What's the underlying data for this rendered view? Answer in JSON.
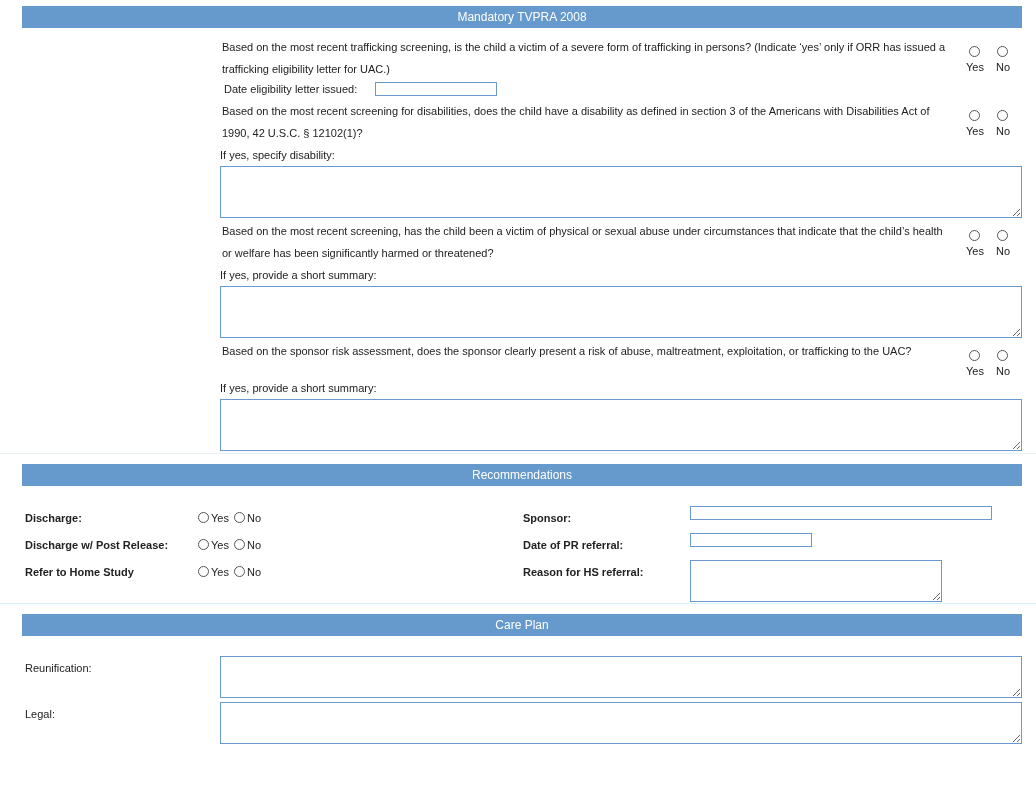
{
  "tvpra": {
    "title": "Mandatory TVPRA 2008",
    "questions": [
      {
        "text": "Based on the most recent trafficking screening, is the child a victim of a severe form of trafficking in persons? (Indicate ‘yes’ only if ORR has issued a trafficking eligibility letter for UAC.)",
        "options": [
          {
            "label": "Yes",
            "selected": false
          },
          {
            "label": "No",
            "selected": false
          }
        ],
        "followup": {
          "kind": "date",
          "label": "Date eligibility letter issued:"
        }
      },
      {
        "text": "Based on the most recent screening for disabilities, does the child have a disability as defined in section 3 of the Americans with Disabilities Act of 1990, 42 U.S.C. § 12102(1)?",
        "options": [
          {
            "label": "Yes",
            "selected": false
          },
          {
            "label": "No",
            "selected": false
          }
        ],
        "followup": {
          "kind": "textarea",
          "label": "If yes, specify disability:"
        }
      },
      {
        "text": "Based on the most recent screening, has the child been a victim of physical or sexual abuse under circumstances that indicate that the child’s health or welfare has been significantly harmed or threatened?",
        "options": [
          {
            "label": "Yes",
            "selected": false
          },
          {
            "label": "No",
            "selected": false
          }
        ],
        "followup": {
          "kind": "textarea",
          "label": "If yes, provide a short summary:"
        }
      },
      {
        "text": "Based on the sponsor risk assessment, does the sponsor clearly present a risk of abuse, maltreatment, exploitation, or trafficking to the UAC?",
        "options": [
          {
            "label": "Yes",
            "selected": false
          },
          {
            "label": "No",
            "selected": false
          }
        ],
        "followup": {
          "kind": "textarea",
          "label": "If yes, provide a short summary:"
        }
      }
    ]
  },
  "recommendations": {
    "title": "Recommendations",
    "rows": [
      {
        "label": "Discharge:",
        "options": [
          {
            "label": "Yes",
            "selected": false
          },
          {
            "label": "No",
            "selected": false
          }
        ],
        "field": {
          "label": "Sponsor:",
          "kind": "wide"
        }
      },
      {
        "label": "Discharge w/ Post Release:",
        "options": [
          {
            "label": "Yes",
            "selected": false
          },
          {
            "label": "No",
            "selected": false
          }
        ],
        "field": {
          "label": "Date of PR referral:",
          "kind": "short"
        }
      },
      {
        "label": "Refer to Home Study",
        "options": [
          {
            "label": "Yes",
            "selected": false
          },
          {
            "label": "No",
            "selected": false
          }
        ],
        "field": {
          "label": "Reason for HS referral:",
          "kind": "textarea"
        }
      }
    ]
  },
  "care_plan": {
    "title": "Care Plan",
    "fields": [
      {
        "label": "Reunification:"
      },
      {
        "label": "Legal:"
      }
    ]
  }
}
